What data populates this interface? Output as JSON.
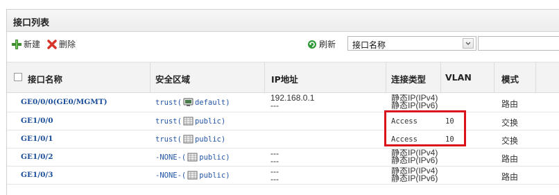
{
  "panel": {
    "title": "接口列表"
  },
  "toolbar": {
    "new_label": "新建",
    "delete_label": "删除",
    "refresh_label": "刷新",
    "search_field_value": "接口名称",
    "search_input_value": ""
  },
  "table": {
    "headers": [
      "接口名称",
      "安全区域",
      "IP地址",
      "连接类型",
      "VLAN",
      "模式"
    ],
    "rows": [
      {
        "name": "GE0/0/0(GE0/MGMT)",
        "zone_prefix": "trust(",
        "zone_vsys": "default)",
        "ip": [
          "192.168.0.1",
          "---"
        ],
        "conn": [
          "静态IP(IPv4)",
          "静态IP(IPv6)"
        ],
        "vlan": "",
        "mode": "路由"
      },
      {
        "name": "GE1/0/0",
        "zone_prefix": "trust(",
        "zone_vsys": "public)",
        "ip": [],
        "conn": [
          "Access"
        ],
        "vlan": "10",
        "mode": "交换"
      },
      {
        "name": "GE1/0/1",
        "zone_prefix": "trust(",
        "zone_vsys": "public)",
        "ip": [],
        "conn": [
          "Access"
        ],
        "vlan": "10",
        "mode": "交换"
      },
      {
        "name": "GE1/0/2",
        "zone_prefix": "-NONE-(",
        "zone_vsys": "public)",
        "ip": [
          "---",
          "---"
        ],
        "conn": [
          "静态IP(IPv4)",
          "静态IP(IPv6)"
        ],
        "vlan": "",
        "mode": "路由"
      },
      {
        "name": "GE1/0/3",
        "zone_prefix": "-NONE-(",
        "zone_vsys": "public)",
        "ip": [
          "---",
          "---"
        ],
        "conn": [
          "静态IP(IPv4)",
          "静态IP(IPv6)"
        ],
        "vlan": "",
        "mode": "路由"
      }
    ]
  },
  "colors": {
    "link": "#1a4d99",
    "highlight": "#d9121b",
    "header_bg": "#f3f3f3"
  }
}
